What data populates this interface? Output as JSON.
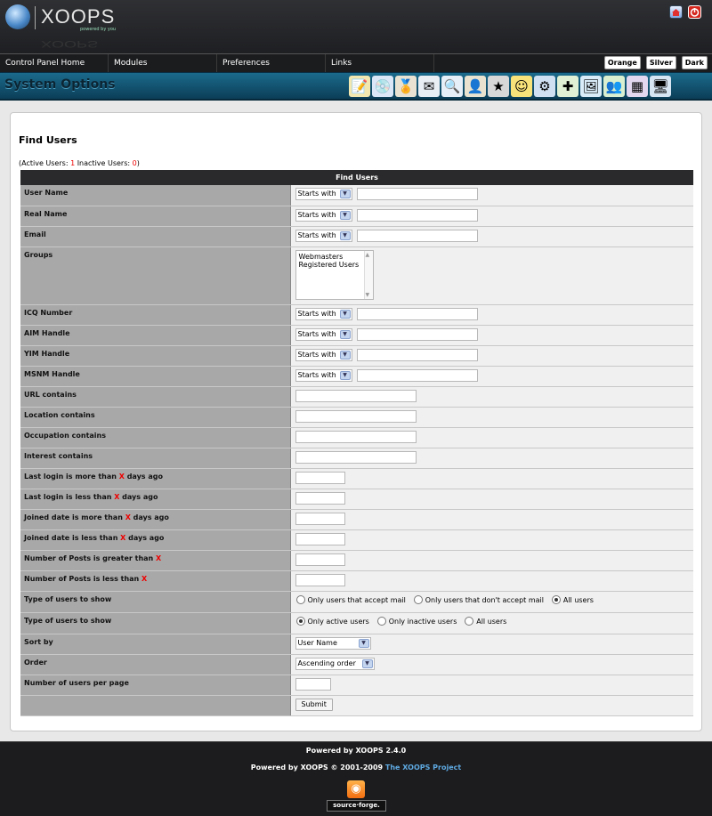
{
  "header": {
    "logo_text": "XOOPS",
    "logo_tagline": "powered by you"
  },
  "nav": {
    "items": [
      "Control Panel Home",
      "Modules",
      "Preferences",
      "Links"
    ],
    "themes": [
      "Orange",
      "Silver",
      "Dark"
    ]
  },
  "system_bar": {
    "title": "System Options",
    "module_icons": [
      "notepad-icon",
      "cd-icon",
      "medal-icon",
      "mail-icon",
      "magnifier-icon",
      "user-icon",
      "star-icon",
      "smiley-icon",
      "settings-icon",
      "plugin-icon",
      "image-icon",
      "users-icon",
      "blocks-icon",
      "monitor-icon"
    ]
  },
  "page": {
    "title": "Find Users",
    "counts": {
      "prefix": "(Active Users: ",
      "active": "1",
      "mid": " Inactive Users: ",
      "inactive": "0",
      "suffix": ")"
    },
    "form_header": "Find Users"
  },
  "form": {
    "user_name": "User Name",
    "real_name": "Real Name",
    "email": "Email",
    "groups": "Groups",
    "groups_options": [
      "Webmasters",
      "Registered Users"
    ],
    "icq": "ICQ Number",
    "aim": "AIM Handle",
    "yim": "YIM Handle",
    "msnm": "MSNM Handle",
    "url": "URL contains",
    "location": "Location contains",
    "occupation": "Occupation contains",
    "interest": "Interest contains",
    "match_value": "Starts with",
    "x": "X",
    "lastlogin_more_a": "Last login is more than ",
    "lastlogin_more_b": " days ago",
    "lastlogin_less_a": "Last login is less than ",
    "lastlogin_less_b": " days ago",
    "joined_more_a": "Joined date is more than ",
    "joined_more_b": " days ago",
    "joined_less_a": "Joined date is less than ",
    "joined_less_b": " days ago",
    "posts_greater": "Number of Posts is greater than ",
    "posts_less": "Number of Posts is less than ",
    "type1_label": "Type of users to show",
    "type1_opts": [
      "Only users that accept mail",
      "Only users that don't accept mail",
      "All users"
    ],
    "type2_label": "Type of users to show",
    "type2_opts": [
      "Only active users",
      "Only inactive users",
      "All users"
    ],
    "sortby_label": "Sort by",
    "sortby_value": "User Name",
    "order_label": "Order",
    "order_value": "Ascending order",
    "perpage_label": "Number of users per page",
    "submit": "Submit"
  },
  "footer": {
    "line1": "Powered by XOOPS 2.4.0",
    "line2": "Powered by XOOPS © 2001-2009 ",
    "link": "The XOOPS Project",
    "sf_badge": "source·forge."
  }
}
